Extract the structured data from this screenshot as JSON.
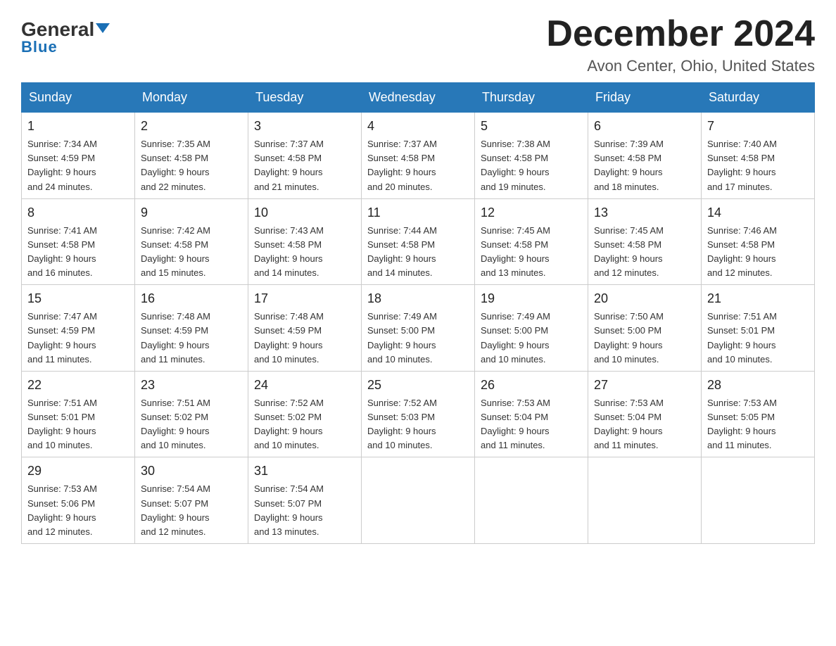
{
  "header": {
    "logo_main": "General",
    "logo_sub": "Blue",
    "month_title": "December 2024",
    "location": "Avon Center, Ohio, United States"
  },
  "weekdays": [
    "Sunday",
    "Monday",
    "Tuesday",
    "Wednesday",
    "Thursday",
    "Friday",
    "Saturday"
  ],
  "weeks": [
    [
      {
        "day": "1",
        "info": "Sunrise: 7:34 AM\nSunset: 4:59 PM\nDaylight: 9 hours\nand 24 minutes."
      },
      {
        "day": "2",
        "info": "Sunrise: 7:35 AM\nSunset: 4:58 PM\nDaylight: 9 hours\nand 22 minutes."
      },
      {
        "day": "3",
        "info": "Sunrise: 7:37 AM\nSunset: 4:58 PM\nDaylight: 9 hours\nand 21 minutes."
      },
      {
        "day": "4",
        "info": "Sunrise: 7:37 AM\nSunset: 4:58 PM\nDaylight: 9 hours\nand 20 minutes."
      },
      {
        "day": "5",
        "info": "Sunrise: 7:38 AM\nSunset: 4:58 PM\nDaylight: 9 hours\nand 19 minutes."
      },
      {
        "day": "6",
        "info": "Sunrise: 7:39 AM\nSunset: 4:58 PM\nDaylight: 9 hours\nand 18 minutes."
      },
      {
        "day": "7",
        "info": "Sunrise: 7:40 AM\nSunset: 4:58 PM\nDaylight: 9 hours\nand 17 minutes."
      }
    ],
    [
      {
        "day": "8",
        "info": "Sunrise: 7:41 AM\nSunset: 4:58 PM\nDaylight: 9 hours\nand 16 minutes."
      },
      {
        "day": "9",
        "info": "Sunrise: 7:42 AM\nSunset: 4:58 PM\nDaylight: 9 hours\nand 15 minutes."
      },
      {
        "day": "10",
        "info": "Sunrise: 7:43 AM\nSunset: 4:58 PM\nDaylight: 9 hours\nand 14 minutes."
      },
      {
        "day": "11",
        "info": "Sunrise: 7:44 AM\nSunset: 4:58 PM\nDaylight: 9 hours\nand 14 minutes."
      },
      {
        "day": "12",
        "info": "Sunrise: 7:45 AM\nSunset: 4:58 PM\nDaylight: 9 hours\nand 13 minutes."
      },
      {
        "day": "13",
        "info": "Sunrise: 7:45 AM\nSunset: 4:58 PM\nDaylight: 9 hours\nand 12 minutes."
      },
      {
        "day": "14",
        "info": "Sunrise: 7:46 AM\nSunset: 4:58 PM\nDaylight: 9 hours\nand 12 minutes."
      }
    ],
    [
      {
        "day": "15",
        "info": "Sunrise: 7:47 AM\nSunset: 4:59 PM\nDaylight: 9 hours\nand 11 minutes."
      },
      {
        "day": "16",
        "info": "Sunrise: 7:48 AM\nSunset: 4:59 PM\nDaylight: 9 hours\nand 11 minutes."
      },
      {
        "day": "17",
        "info": "Sunrise: 7:48 AM\nSunset: 4:59 PM\nDaylight: 9 hours\nand 10 minutes."
      },
      {
        "day": "18",
        "info": "Sunrise: 7:49 AM\nSunset: 5:00 PM\nDaylight: 9 hours\nand 10 minutes."
      },
      {
        "day": "19",
        "info": "Sunrise: 7:49 AM\nSunset: 5:00 PM\nDaylight: 9 hours\nand 10 minutes."
      },
      {
        "day": "20",
        "info": "Sunrise: 7:50 AM\nSunset: 5:00 PM\nDaylight: 9 hours\nand 10 minutes."
      },
      {
        "day": "21",
        "info": "Sunrise: 7:51 AM\nSunset: 5:01 PM\nDaylight: 9 hours\nand 10 minutes."
      }
    ],
    [
      {
        "day": "22",
        "info": "Sunrise: 7:51 AM\nSunset: 5:01 PM\nDaylight: 9 hours\nand 10 minutes."
      },
      {
        "day": "23",
        "info": "Sunrise: 7:51 AM\nSunset: 5:02 PM\nDaylight: 9 hours\nand 10 minutes."
      },
      {
        "day": "24",
        "info": "Sunrise: 7:52 AM\nSunset: 5:02 PM\nDaylight: 9 hours\nand 10 minutes."
      },
      {
        "day": "25",
        "info": "Sunrise: 7:52 AM\nSunset: 5:03 PM\nDaylight: 9 hours\nand 10 minutes."
      },
      {
        "day": "26",
        "info": "Sunrise: 7:53 AM\nSunset: 5:04 PM\nDaylight: 9 hours\nand 11 minutes."
      },
      {
        "day": "27",
        "info": "Sunrise: 7:53 AM\nSunset: 5:04 PM\nDaylight: 9 hours\nand 11 minutes."
      },
      {
        "day": "28",
        "info": "Sunrise: 7:53 AM\nSunset: 5:05 PM\nDaylight: 9 hours\nand 11 minutes."
      }
    ],
    [
      {
        "day": "29",
        "info": "Sunrise: 7:53 AM\nSunset: 5:06 PM\nDaylight: 9 hours\nand 12 minutes."
      },
      {
        "day": "30",
        "info": "Sunrise: 7:54 AM\nSunset: 5:07 PM\nDaylight: 9 hours\nand 12 minutes."
      },
      {
        "day": "31",
        "info": "Sunrise: 7:54 AM\nSunset: 5:07 PM\nDaylight: 9 hours\nand 13 minutes."
      },
      {
        "day": "",
        "info": ""
      },
      {
        "day": "",
        "info": ""
      },
      {
        "day": "",
        "info": ""
      },
      {
        "day": "",
        "info": ""
      }
    ]
  ]
}
